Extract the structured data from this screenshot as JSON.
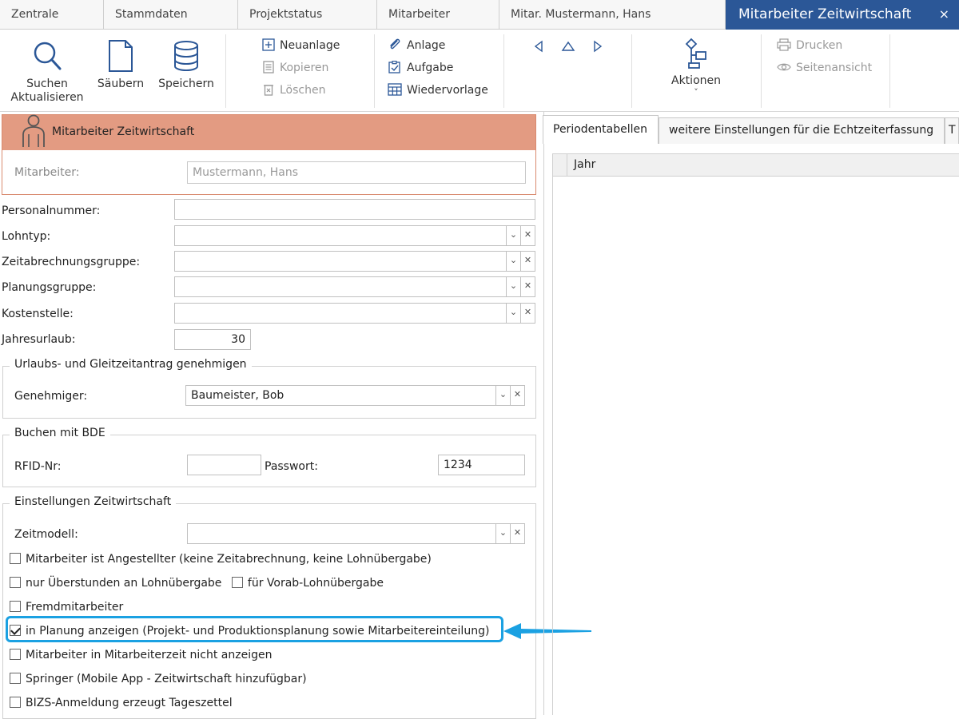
{
  "tabs": [
    {
      "label": "Zentrale"
    },
    {
      "label": "Stammdaten"
    },
    {
      "label": "Projektstatus"
    },
    {
      "label": "Mitarbeiter"
    },
    {
      "label": "Mitar. Mustermann, Hans"
    },
    {
      "label": "Mitarbeiter Zeitwirtschaft",
      "close": "×"
    }
  ],
  "ribbon": {
    "search_line1": "Suchen",
    "search_line2": "Aktualisieren",
    "clear": "Säubern",
    "save": "Speichern",
    "new": "Neuanlage",
    "copy": "Kopieren",
    "delete": "Löschen",
    "attachment": "Anlage",
    "task": "Aufgabe",
    "resubmission": "Wiedervorlage",
    "actions": "Aktionen",
    "actions_caret": "˅",
    "print": "Drucken",
    "preview": "Seitenansicht"
  },
  "employee_box": {
    "title": "Mitarbeiter Zeitwirtschaft",
    "label": "Mitarbeiter:",
    "value": "Mustermann, Hans"
  },
  "fields": {
    "personnel_number": {
      "label": "Personalnummer:",
      "value": ""
    },
    "wage_type": {
      "label": "Lohntyp:",
      "value": ""
    },
    "billing_group": {
      "label": "Zeitabrechnungsgruppe:",
      "value": ""
    },
    "planning_group": {
      "label": "Planungsgruppe:",
      "value": ""
    },
    "cost_center": {
      "label": "Kostenstelle:",
      "value": ""
    },
    "annual_leave": {
      "label": "Jahresurlaub:",
      "value": "30"
    }
  },
  "combo": {
    "down": "⌄",
    "clear": "✕"
  },
  "approval_group": {
    "legend": "Urlaubs- und Gleitzeitantrag genehmigen",
    "approver_label": "Genehmiger:",
    "approver_value": "Baumeister, Bob"
  },
  "bde_group": {
    "legend": "Buchen mit BDE",
    "rfid_label": "RFID-Nr:",
    "rfid_value": "",
    "password_label": "Passwort:",
    "password_value": "1234"
  },
  "settings_group": {
    "legend": "Einstellungen Zeitwirtschaft",
    "model_label": "Zeitmodell:",
    "model_value": "",
    "checkboxes": [
      {
        "label": "Mitarbeiter ist Angestellter (keine Zeitabrechnung, keine Lohnübergabe)",
        "checked": false
      },
      {
        "label": "nur Überstunden an Lohnübergabe",
        "checked": false
      },
      {
        "label": "für Vorab-Lohnübergabe",
        "checked": false
      },
      {
        "label": "Fremdmitarbeiter",
        "checked": false
      },
      {
        "label": "in Planung anzeigen (Projekt- und Produktionsplanung sowie Mitarbeitereinteilung)",
        "checked": true
      },
      {
        "label": "Mitarbeiter in Mitarbeiterzeit nicht anzeigen",
        "checked": false
      },
      {
        "label": "Springer (Mobile App - Zeitwirtschaft hinzufügbar)",
        "checked": false
      },
      {
        "label": "BIZS-Anmeldung erzeugt Tageszettel",
        "checked": false
      }
    ]
  },
  "right_panel": {
    "tabs": [
      {
        "label": "Periodentabellen"
      },
      {
        "label": "weitere Einstellungen für die Echtzeiterfassung"
      },
      {
        "label": "T"
      }
    ],
    "grid_column": "Jahr"
  },
  "colors": {
    "active_tab": "#2b5797",
    "employee_header": "#e39b82",
    "highlight": "#1ba1e2"
  }
}
